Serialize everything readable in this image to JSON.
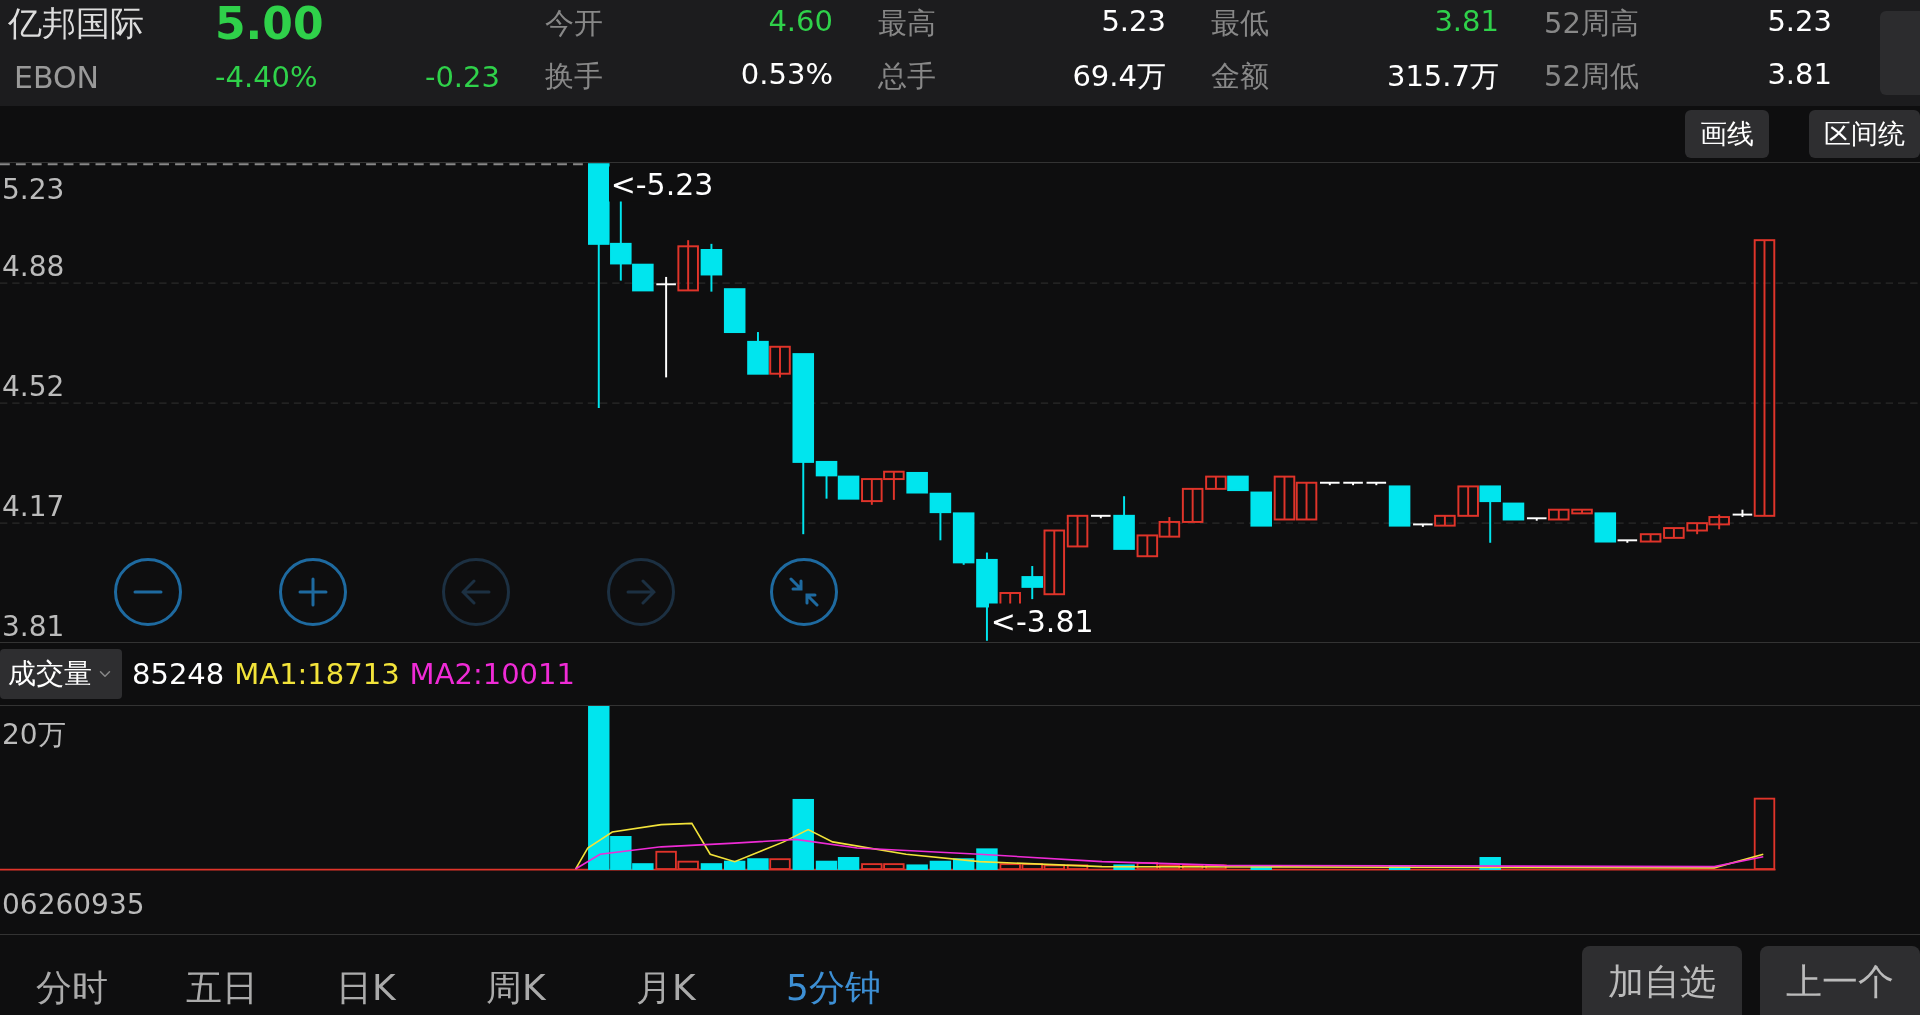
{
  "stock": {
    "name": "亿邦国际",
    "price": "5.00",
    "code": "EBON",
    "change_pct": "-4.40%",
    "change": "-0.23"
  },
  "quotes": [
    {
      "label": "今开",
      "value": "4.60",
      "color": "#2fd14a"
    },
    {
      "label": "最高",
      "value": "5.23",
      "color": "#ffffff"
    },
    {
      "label": "最低",
      "value": "3.81",
      "color": "#2fd14a"
    },
    {
      "label": "52周高",
      "value": "5.23",
      "color": "#ffffff"
    },
    {
      "label": "换手",
      "value": "0.53%",
      "color": "#ffffff"
    },
    {
      "label": "总手",
      "value": "69.4万",
      "color": "#ffffff"
    },
    {
      "label": "金额",
      "value": "315.7万",
      "color": "#ffffff"
    },
    {
      "label": "52周低",
      "value": "3.81",
      "color": "#ffffff"
    }
  ],
  "tools": [
    "画线",
    "区间统"
  ],
  "price_axis": [
    "5.23",
    "4.88",
    "4.52",
    "4.17",
    "3.81"
  ],
  "markers": {
    "high": "<-5.23",
    "low": "<-3.81"
  },
  "zoom_controls": [
    {
      "kind": "minus",
      "disabled": false
    },
    {
      "kind": "plus",
      "disabled": false
    },
    {
      "kind": "left",
      "disabled": true
    },
    {
      "kind": "right",
      "disabled": true
    },
    {
      "kind": "shrink",
      "disabled": false
    }
  ],
  "volume": {
    "indicator": "成交量",
    "current": "85248",
    "ma1": "MA1:18713",
    "ma2": "MA2:10011",
    "axis_label": "20万",
    "time_label": "06260935"
  },
  "period_tabs": [
    {
      "label": "分时",
      "selected": false
    },
    {
      "label": "五日",
      "selected": false
    },
    {
      "label": "日K",
      "selected": false
    },
    {
      "label": "周K",
      "selected": false
    },
    {
      "label": "月K",
      "selected": false
    },
    {
      "label": "5分钟",
      "selected": true
    }
  ],
  "actions": [
    "加自选",
    "上一个"
  ]
}
